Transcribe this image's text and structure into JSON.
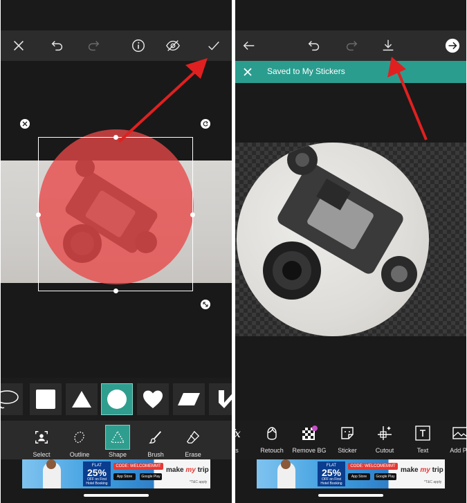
{
  "left": {
    "toolbar": {
      "close_icon": "close-icon",
      "undo_icon": "undo-icon",
      "redo_icon": "redo-icon",
      "info_icon": "info-icon",
      "hide_icon": "eye-off-icon",
      "apply_icon": "check-icon"
    },
    "shapes": [
      "lasso",
      "square",
      "triangle",
      "circle",
      "heart",
      "parallelogram",
      "chevron"
    ],
    "active_shape": "circle",
    "tools": [
      {
        "label": "Select",
        "icon": "select-person-icon"
      },
      {
        "label": "Outline",
        "icon": "outline-icon"
      },
      {
        "label": "Shape",
        "icon": "shape-triangle-icon"
      },
      {
        "label": "Brush",
        "icon": "brush-icon"
      },
      {
        "label": "Erase",
        "icon": "eraser-icon"
      }
    ],
    "active_tool": "Shape",
    "overlay_color": "#e84848"
  },
  "right": {
    "toolbar": {
      "back_icon": "arrow-left-icon",
      "undo_icon": "undo-icon",
      "redo_icon": "redo-icon",
      "download_icon": "download-icon",
      "next_icon": "arrow-right-circle-icon"
    },
    "banner": {
      "text": "Saved to My Stickers",
      "color": "#2a9d8f"
    },
    "tools": [
      {
        "label": "cts",
        "icon": "effects-icon"
      },
      {
        "label": "Retouch",
        "icon": "retouch-icon"
      },
      {
        "label": "Remove BG",
        "icon": "remove-bg-icon"
      },
      {
        "label": "Sticker",
        "icon": "sticker-icon"
      },
      {
        "label": "Cutout",
        "icon": "cutout-icon"
      },
      {
        "label": "Text",
        "icon": "text-icon"
      },
      {
        "label": "Add Ph",
        "icon": "add-photo-icon"
      }
    ]
  },
  "ad": {
    "flat": "FLAT",
    "percent": "25%",
    "off": "OFF on First Hotel Booking",
    "code": "CODE: WELCOMEMMT",
    "app_store": "App Store",
    "google_play": "Google Play",
    "brand_make": "make",
    "brand_my": "my",
    "brand_trip": "trip",
    "tac": "*T&C apply"
  },
  "annotation_color": "#e02020"
}
